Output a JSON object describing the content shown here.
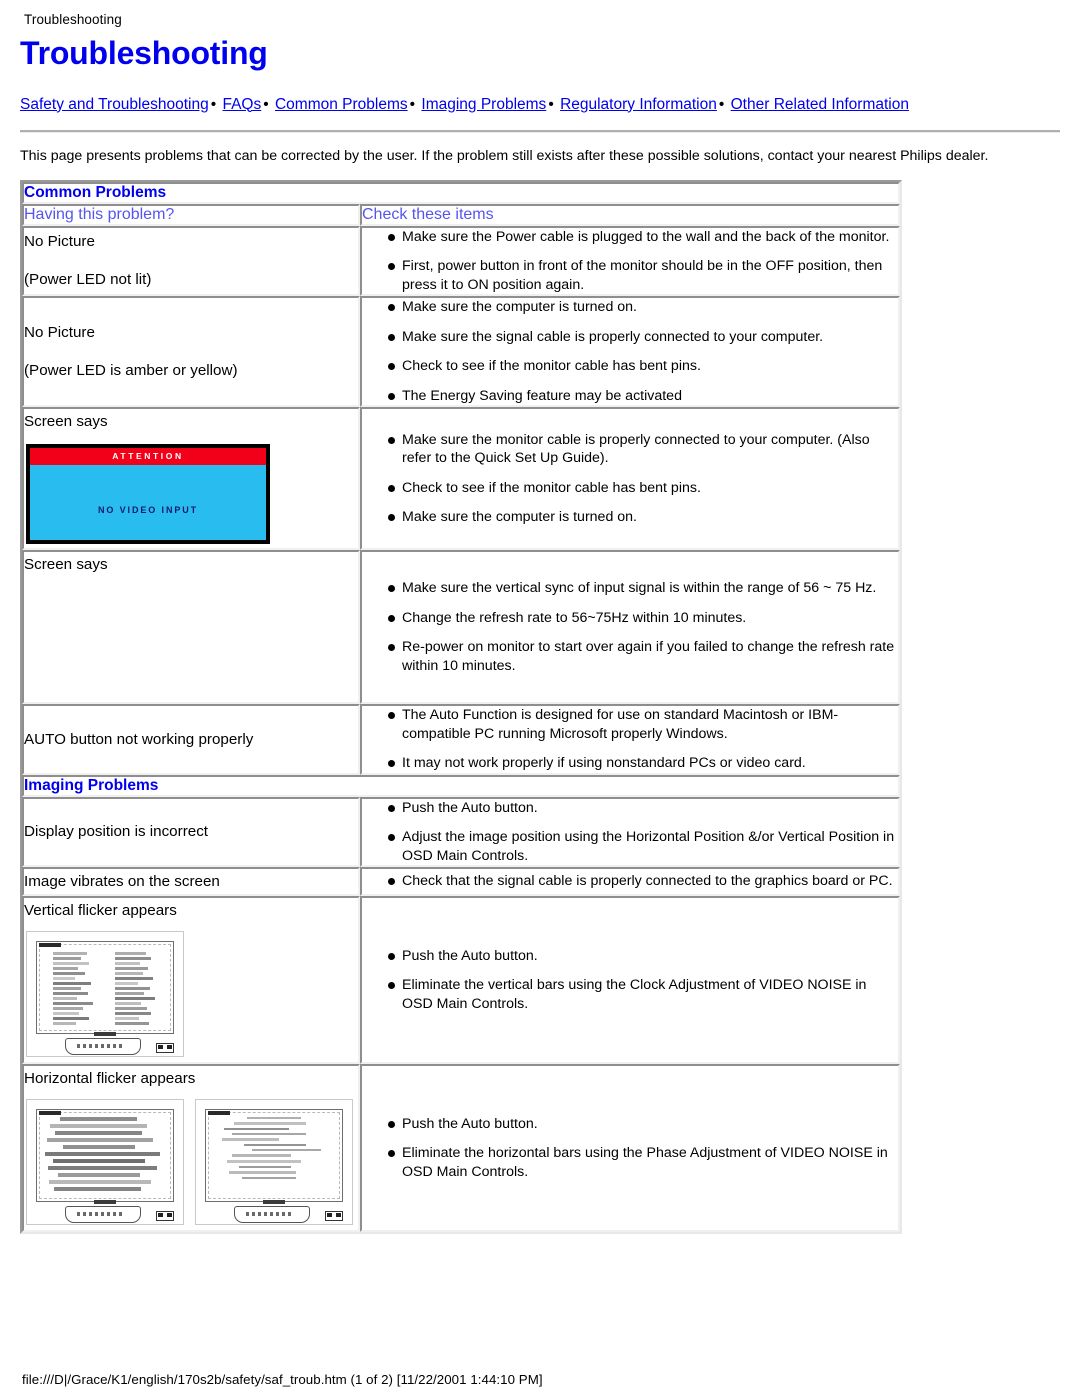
{
  "breadcrumb": "Troubleshooting",
  "page_title": "Troubleshooting",
  "colors": {
    "link": "#0000ee",
    "heading": "#0000ee",
    "col_header": "#5555ee",
    "attention_bar": "#f20019",
    "attention_screen": "#29bdef",
    "attention_text": "#131a6b"
  },
  "nav": {
    "separator": "•",
    "links": [
      "Safety and Troubleshooting",
      "FAQs",
      "Common Problems",
      "Imaging Problems",
      "Regulatory Information",
      "Other Related Information"
    ]
  },
  "intro": "This page presents problems that can be corrected by the user. If the problem still exists after these possible solutions, contact your nearest Philips dealer.",
  "table": {
    "section_common": "Common Problems",
    "col_header_left": "Having this problem?",
    "col_header_right": "Check these items",
    "section_imaging": "Imaging Problems",
    "rows": [
      {
        "problem_lines": [
          "No Picture",
          "(Power LED not lit)"
        ],
        "checks": [
          "Make sure the Power cable is plugged to the wall and the back of the monitor.",
          "First, power button in front of the monitor should be in the OFF position, then press it to ON position again."
        ]
      },
      {
        "problem_lines": [
          "No Picture",
          "(Power LED is amber or yellow)"
        ],
        "checks": [
          "Make sure the computer is turned on.",
          "Make sure the signal cable is properly connected to your computer.",
          "Check to see if the monitor cable has bent pins.",
          "The Energy Saving feature may be activated"
        ]
      },
      {
        "problem_lines": [
          "Screen says"
        ],
        "graphic": "attention-no-video-input",
        "checks": [
          "Make sure the monitor cable is properly connected to your computer. (Also refer to the Quick Set Up Guide).",
          "Check to see if the monitor cable has bent pins.",
          "Make sure the computer is turned on."
        ]
      },
      {
        "problem_lines": [
          "Screen says"
        ],
        "graphic": "blank-placeholder",
        "checks": [
          "Make sure the vertical sync of input signal is within the range of 56 ~ 75 Hz.",
          "Change the refresh rate to 56~75Hz within 10 minutes.",
          "Re-power on monitor to start over again if you failed to change the refresh rate within 10 minutes."
        ]
      },
      {
        "problem_lines": [
          "AUTO button not working properly"
        ],
        "checks": [
          "The Auto Function is designed for use on standard Macintosh or IBM-compatible PC running Microsoft properly Windows.",
          "It may not work properly if using nonstandard PCs or video card."
        ]
      }
    ],
    "imaging_rows": [
      {
        "problem_lines": [
          "Display position is incorrect"
        ],
        "checks": [
          "Push the Auto button.",
          "Adjust the image position using the Horizontal Position &/or Vertical Position in OSD Main Controls."
        ]
      },
      {
        "problem_lines": [
          "Image vibrates on the screen"
        ],
        "checks": [
          "Check that the signal cable is properly connected to the graphics board or PC."
        ]
      },
      {
        "problem_lines": [
          "Vertical flicker appears"
        ],
        "graphic": "monitor-vertical-bars",
        "checks": [
          "Push the Auto button.",
          "Eliminate the vertical bars using the Clock Adjustment of VIDEO NOISE in OSD Main Controls."
        ]
      },
      {
        "problem_lines": [
          "Horizontal flicker appears"
        ],
        "graphic": "monitor-horizontal-bars-pair",
        "checks": [
          "Push the Auto button.",
          "Eliminate the horizontal bars using the Phase Adjustment of VIDEO NOISE in OSD Main Controls."
        ]
      }
    ]
  },
  "attention_graphic": {
    "title": "ATTENTION",
    "message": "NO VIDEO INPUT"
  },
  "footer": "file:///D|/Grace/K1/english/170s2b/safety/saf_troub.htm (1 of 2) [11/22/2001 1:44:10 PM]"
}
